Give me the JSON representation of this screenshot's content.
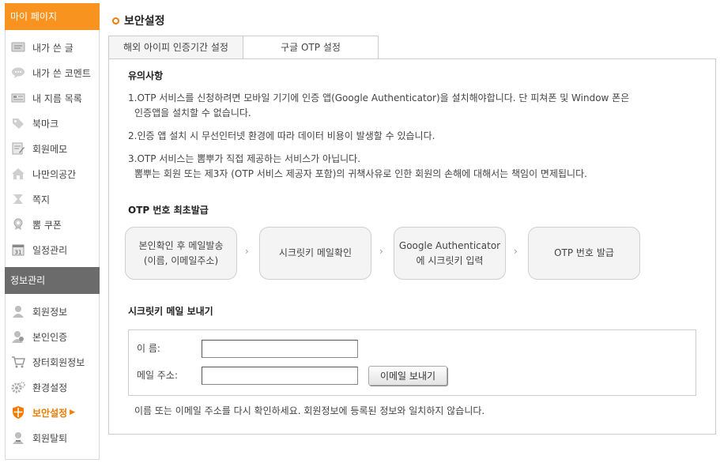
{
  "sidebar": {
    "section1_title": "마이 페이지",
    "section1_items": [
      {
        "label": "내가 쓴 글",
        "icon": "document-icon"
      },
      {
        "label": "내가 쓴 코멘트",
        "icon": "speech-bubble-icon"
      },
      {
        "label": "내 지름 목록",
        "icon": "list-icon"
      },
      {
        "label": "북마크",
        "icon": "tag-icon"
      },
      {
        "label": "회원메모",
        "icon": "memo-icon"
      },
      {
        "label": "나만의공간",
        "icon": "house-icon"
      },
      {
        "label": "쪽지",
        "icon": "message-icon"
      },
      {
        "label": "뽐 쿠폰",
        "icon": "medal-icon"
      },
      {
        "label": "일정관리",
        "icon": "calendar-icon"
      }
    ],
    "calendar_icon_text": "31",
    "section2_title": "정보관리",
    "section2_items": [
      {
        "label": "회원정보",
        "icon": "user-icon"
      },
      {
        "label": "본인인증",
        "icon": "user-check-icon"
      },
      {
        "label": "장터회원정보",
        "icon": "cart-icon"
      },
      {
        "label": "환경설정",
        "icon": "gear-icon"
      },
      {
        "label": "보안설정",
        "icon": "shield-icon",
        "active": true,
        "arrow": "▶"
      },
      {
        "label": "회원탈퇴",
        "icon": "user-leave-icon"
      }
    ]
  },
  "page": {
    "title": "보안설정",
    "tabs": [
      "해외 아이피 인증기간 설정",
      "구글 OTP 설정"
    ],
    "notice_title": "유의사항",
    "notices": {
      "n1_line1": "1.OTP 서비스를 신청하려면 모바일 기기에 인증 앱(Google Authenticator)을 설치해야합니다. 단 피쳐폰 및 Window 폰은",
      "n1_line2": "인증앱을 설치할 수 없습니다.",
      "n2": "2.인증 앱 설치 시 무선인터넷 환경에 따라 데이터 비용이 발생할 수 있습니다.",
      "n3_line1": "3.OTP 서비스는 뽐뿌가 직접 제공하는 서비스가 아닙니다.",
      "n3_line2": "뽐뿌는 회원 또는 제3자 (OTP 서비스 제공자 포함)의 귀책사유로 인한 회원의 손해에 대해서는 책임이 면제됩니다."
    },
    "steps_title": "OTP 번호 최초발급",
    "steps": [
      {
        "line1": "본인확인 후 메일발송",
        "line2": "(이름, 이메일주소)"
      },
      {
        "line1": "시크릿키 메일확인",
        "line2": ""
      },
      {
        "line1": "Google Authenticator",
        "line2": "에 시크릿키 입력"
      },
      {
        "line1": "OTP 번호 발급",
        "line2": ""
      }
    ],
    "chevron": "›",
    "form_title": "시크릿키 메일 보내기",
    "form": {
      "name_label": "이 름:",
      "name_value": "",
      "email_label": "메일 주소:",
      "email_value": "",
      "send_button": "이메일 보내기"
    },
    "footer_note": "이름 또는 이메일 주소를 다시 확인하세요. 회원정보에 등록된 정보와 일치하지 않습니다."
  },
  "colors": {
    "accent": "#f07b00",
    "sidebar_head_orange": "#f7931e",
    "sidebar_head_gray": "#6b6b6b"
  }
}
